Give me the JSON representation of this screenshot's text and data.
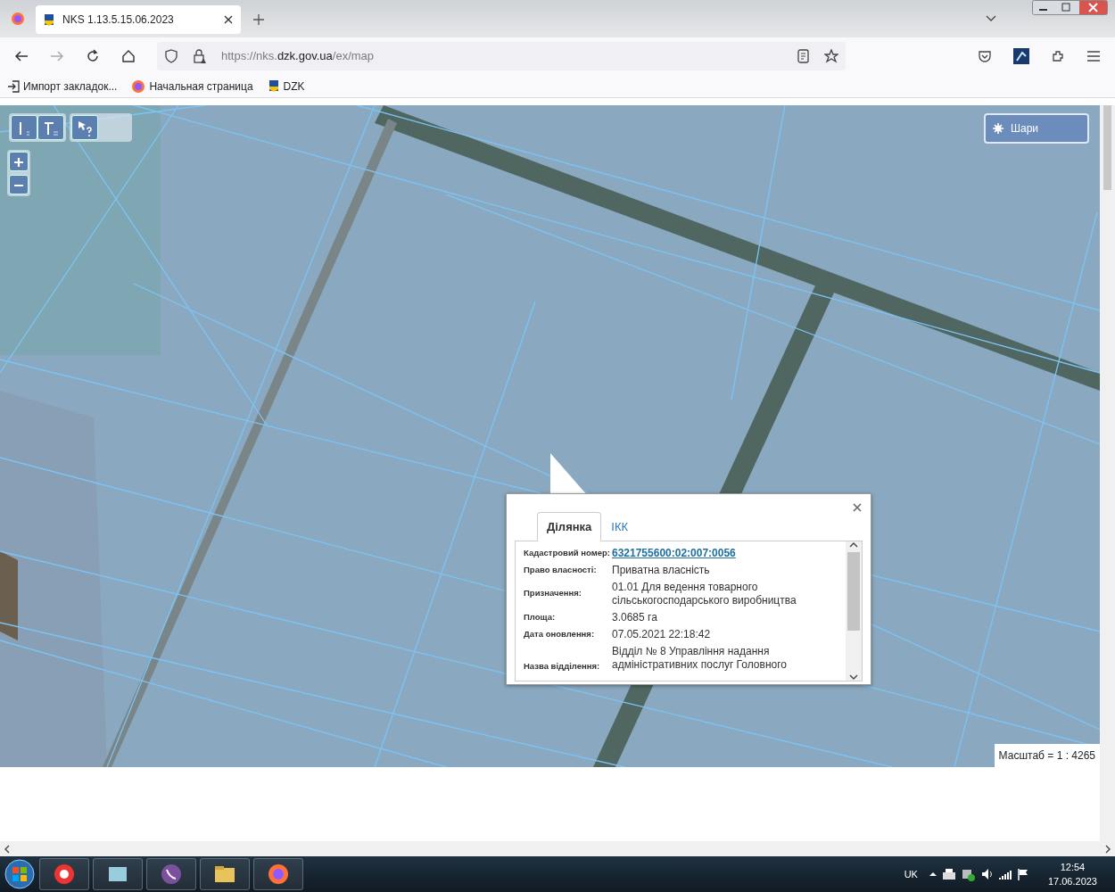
{
  "browser": {
    "tabs": [
      {
        "title": "NKS 1.13.5.15.06.2023",
        "selected": true
      }
    ],
    "url": {
      "prefix": "https://nks.",
      "domain": "dzk.gov.ua",
      "path": "/ex/map"
    },
    "bookmarks": [
      {
        "label": "Импорт закладок...",
        "kind": "import"
      },
      {
        "label": "Начальная страница",
        "kind": "firefox"
      },
      {
        "label": "DZK",
        "kind": "dzk"
      }
    ]
  },
  "map": {
    "layers_button": "Шари",
    "scale": "Масштаб = 1 : 4265",
    "popup": {
      "tabs": [
        {
          "label": "Ділянка",
          "selected": true
        },
        {
          "label": "ІКК",
          "selected": false
        }
      ],
      "fields": [
        {
          "label": "Кадастровий номер:",
          "value": "6321755600:02:007:0056",
          "kind": "link"
        },
        {
          "label": "Право власності:",
          "value": "Приватна власність",
          "kind": "text"
        },
        {
          "label": "Призначення:",
          "value": "01.01 Для ведення товарного сільськогосподарського виробництва",
          "kind": "text"
        },
        {
          "label": "Площа:",
          "value": "3.0685 га",
          "kind": "text"
        },
        {
          "label": "Дата оновлення:",
          "value": "07.05.2021 22:18:42",
          "kind": "text"
        },
        {
          "label": "Назва відділення:",
          "value": "Відділ № 8 Управління надання адміністративних послуг Головного",
          "kind": "text"
        }
      ]
    }
  },
  "taskbar": {
    "language": "UK",
    "time": "12:54",
    "date": "17.06.2023"
  }
}
